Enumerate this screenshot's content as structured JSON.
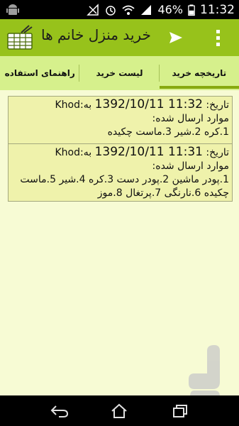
{
  "status_bar": {
    "battery_percent": "46%",
    "time": "11:32"
  },
  "app_bar": {
    "title": "خرید منزل خانم ها",
    "icons": [
      "basket-icon",
      "send-icon",
      "overflow-menu-icon"
    ]
  },
  "tabs": [
    {
      "label": "راهنمای استفاده",
      "active": false
    },
    {
      "label": "لیست خرید",
      "active": false
    },
    {
      "label": "تاریخچه خرید",
      "active": true
    }
  ],
  "history": [
    {
      "date_label": "تاریخ:",
      "datetime": "1392/10/11 11:32",
      "to_label": "به:",
      "to_value": "Khod",
      "items_label": "موارد ارسال شده:",
      "items_text": "1.کره 2.شیر 3.ماست چکیده"
    },
    {
      "date_label": "تاریخ:",
      "datetime": "1392/10/11 11:31",
      "to_label": "به:",
      "to_value": "Khod",
      "items_label": "موارد ارسال شده:",
      "items_text": "1.پودر ماشین 2.پودر دست 3.کره 4.شیر 5.ماست چکیده 6.نارنگی 7.پرتغال 8.موز"
    }
  ],
  "colors": {
    "action_bar": "#97c21b",
    "tabs_bg": "#d6f08c",
    "tab_indicator": "#87a90f",
    "content_bg": "#f7fbd4",
    "card_bg": "#eff2ab"
  },
  "nav_icons": [
    "back-icon",
    "home-icon",
    "recent-apps-icon"
  ]
}
